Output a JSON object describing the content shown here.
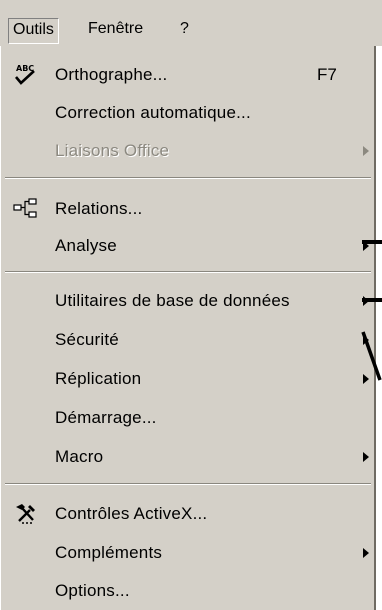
{
  "menubar": {
    "items": [
      {
        "label": "Outils",
        "active": true
      },
      {
        "label": "Fenêtre",
        "active": false
      },
      {
        "label": "?",
        "active": false
      }
    ]
  },
  "dropdown": {
    "items": [
      {
        "label": "Orthographe...",
        "shortcut": "F7",
        "icon": "spelling-abc-check-icon",
        "enabled": true,
        "submenu": false
      },
      {
        "label": "Correction automatique...",
        "enabled": true,
        "submenu": false
      },
      {
        "label": "Liaisons Office",
        "enabled": false,
        "submenu": true
      },
      {
        "label": "Relations...",
        "icon": "relationships-icon",
        "enabled": true,
        "submenu": false
      },
      {
        "label": "Analyse",
        "enabled": true,
        "submenu": true
      },
      {
        "label": "Utilitaires de base de données",
        "enabled": true,
        "submenu": true
      },
      {
        "label": "Sécurité",
        "enabled": true,
        "submenu": true
      },
      {
        "label": "Réplication",
        "enabled": true,
        "submenu": true
      },
      {
        "label": "Démarrage...",
        "enabled": true,
        "submenu": false
      },
      {
        "label": "Macro",
        "enabled": true,
        "submenu": true
      },
      {
        "label": "Contrôles ActiveX...",
        "icon": "activex-tools-icon",
        "enabled": true,
        "submenu": false
      },
      {
        "label": "Compléments",
        "enabled": true,
        "submenu": true
      },
      {
        "label": "Options...",
        "enabled": true,
        "submenu": false
      }
    ]
  },
  "colors": {
    "menu_background": "#d4d0c8",
    "disabled_text": "#8c8980",
    "text": "#000000"
  }
}
